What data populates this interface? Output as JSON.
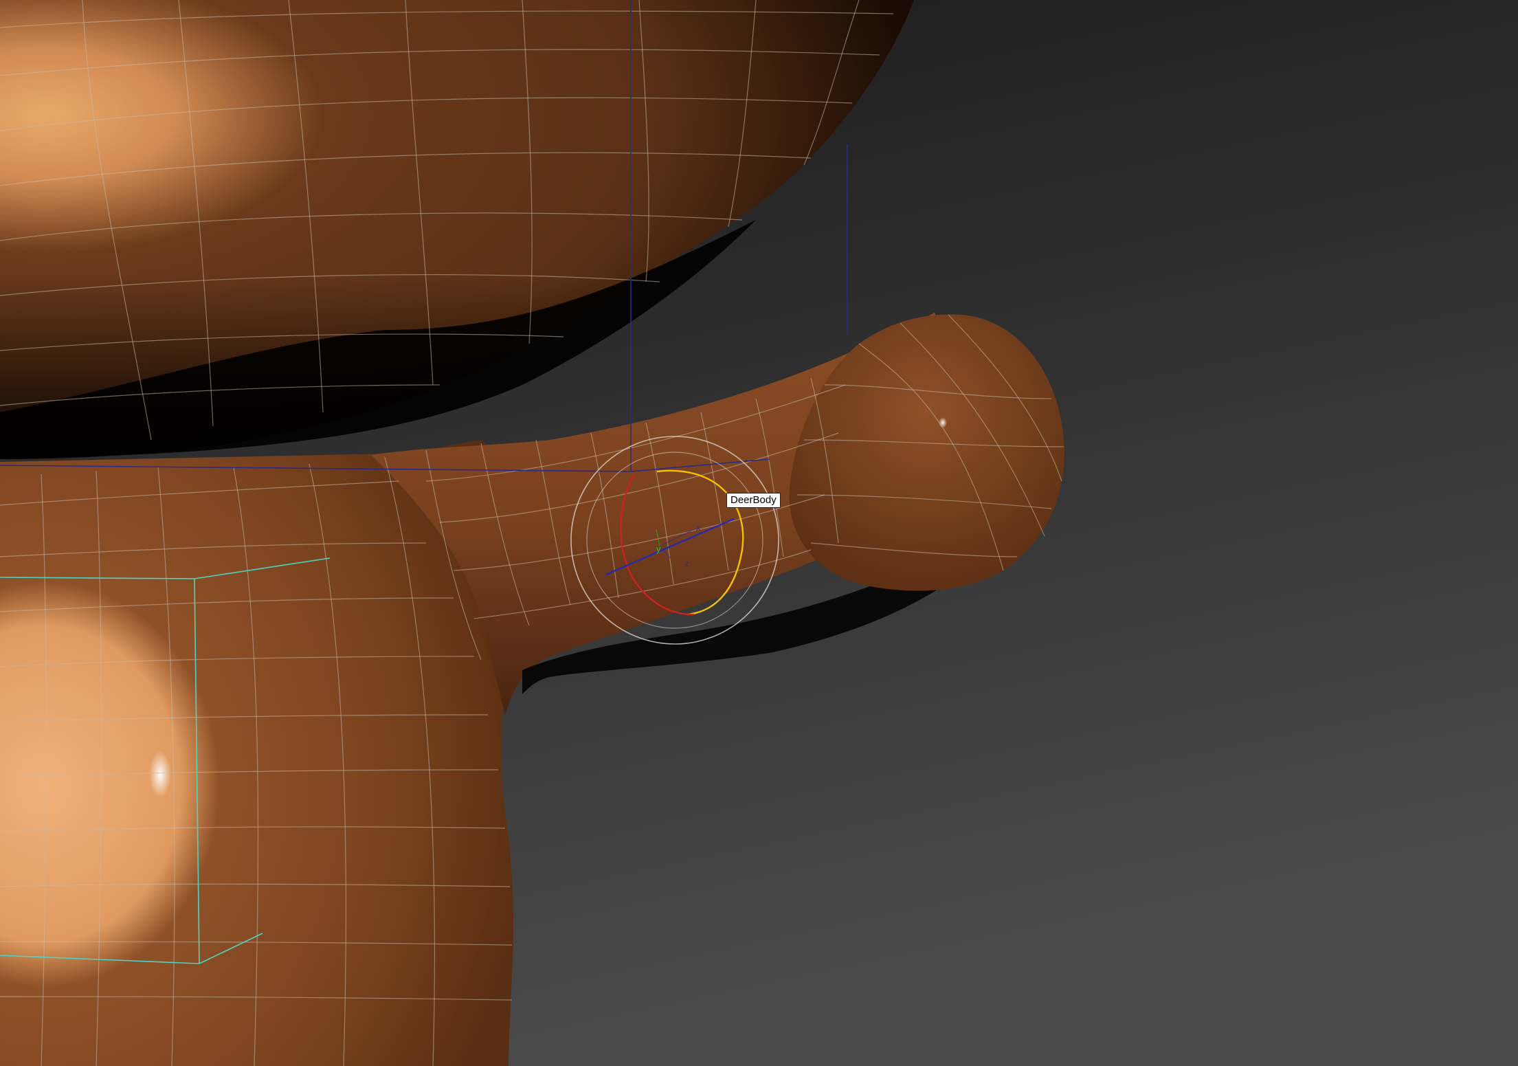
{
  "viewport": {
    "selected_object_label": "DeerBody",
    "gizmo": {
      "type": "rotate",
      "axis_labels": {
        "x": "x",
        "y": "y",
        "z": "z"
      },
      "axis_colors": {
        "x": "#cc2222",
        "y": "#f2c200",
        "z": "#2a2aa8",
        "screen": "#e0d4c8"
      }
    },
    "colors": {
      "background_top": "#1b1b1b",
      "background_bottom": "#474747",
      "skin_dark": "#6e3d1c",
      "skin_mid": "#8a4d26",
      "skin_light": "#e8a56a",
      "wireframe": "#c8b8a6",
      "bounding_box_blue": "#2a2a8a",
      "bounding_box_cyan": "#4ed4c4"
    }
  }
}
